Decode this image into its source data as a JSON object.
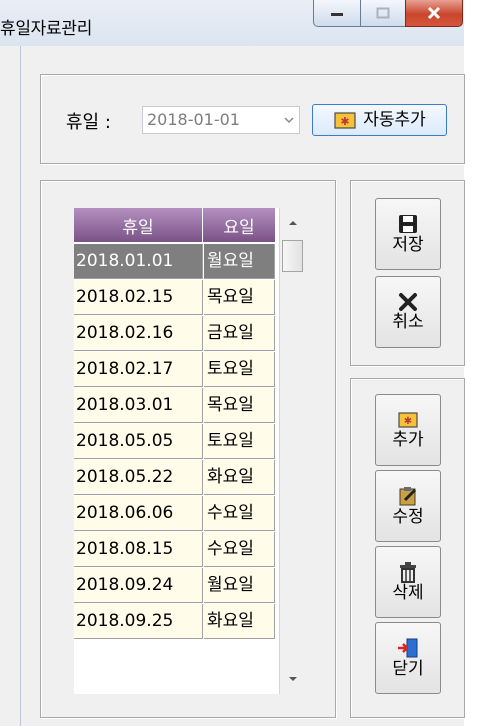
{
  "window": {
    "title": "휴일자료관리",
    "controls": {
      "minimize": "minimize",
      "maximize": "maximize",
      "close": "close"
    }
  },
  "filter": {
    "label": "휴일  :",
    "date_value": "2018-01-01",
    "auto_add_label": "자동추가"
  },
  "grid": {
    "headers": {
      "holiday": "휴일",
      "weekday": "요일"
    },
    "rows": [
      {
        "date": "2018.01.01",
        "day": "월요일",
        "selected": true
      },
      {
        "date": "2018.02.15",
        "day": "목요일"
      },
      {
        "date": "2018.02.16",
        "day": "금요일"
      },
      {
        "date": "2018.02.17",
        "day": "토요일"
      },
      {
        "date": "2018.03.01",
        "day": "목요일"
      },
      {
        "date": "2018.05.05",
        "day": "토요일"
      },
      {
        "date": "2018.05.22",
        "day": "화요일"
      },
      {
        "date": "2018.06.06",
        "day": "수요일"
      },
      {
        "date": "2018.08.15",
        "day": "수요일"
      },
      {
        "date": "2018.09.24",
        "day": "월요일"
      },
      {
        "date": "2018.09.25",
        "day": "화요일"
      }
    ]
  },
  "actions": {
    "save": "저장",
    "cancel": "취소",
    "add": "추가",
    "edit": "수정",
    "delete": "삭제",
    "close": "닫기"
  },
  "colors": {
    "header_purple": "#8f66a0",
    "cell_bg": "#fffdea",
    "selected_bg": "#7f7f7f",
    "icon_orange": "#f2a516"
  }
}
